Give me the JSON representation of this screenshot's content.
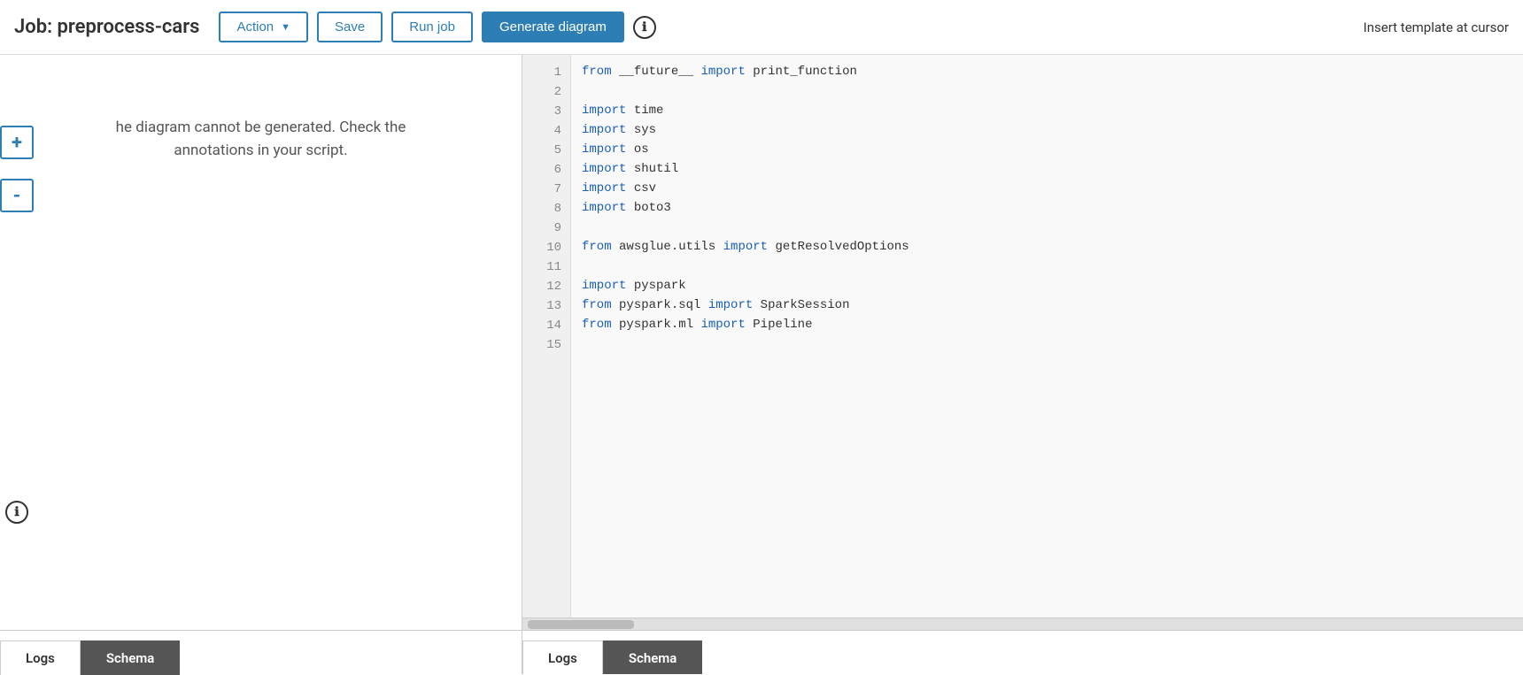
{
  "header": {
    "job_title": "Job: preprocess-cars",
    "action_label": "Action",
    "save_label": "Save",
    "run_job_label": "Run job",
    "generate_diagram_label": "Generate diagram",
    "info_icon": "ℹ",
    "insert_template_label": "Insert template at cursor"
  },
  "left_panel": {
    "error_message_line1": "he diagram cannot be generated. Check the",
    "error_message_line2": "annotations in your script.",
    "zoom_plus": "+",
    "zoom_minus": "-"
  },
  "tabs_left": {
    "logs_label": "Logs",
    "schema_label": "Schema",
    "active": "Schema"
  },
  "code_editor": {
    "lines": [
      {
        "num": 1,
        "code": "from __future__ import print_function"
      },
      {
        "num": 2,
        "code": ""
      },
      {
        "num": 3,
        "code": "import time"
      },
      {
        "num": 4,
        "code": "import sys"
      },
      {
        "num": 5,
        "code": "import os"
      },
      {
        "num": 6,
        "code": "import shutil"
      },
      {
        "num": 7,
        "code": "import csv"
      },
      {
        "num": 8,
        "code": "import boto3"
      },
      {
        "num": 9,
        "code": ""
      },
      {
        "num": 10,
        "code": "from awsglue.utils import getResolvedOptions"
      },
      {
        "num": 11,
        "code": ""
      },
      {
        "num": 12,
        "code": "import pyspark"
      },
      {
        "num": 13,
        "code": "from pyspark.sql import SparkSession"
      },
      {
        "num": 14,
        "code": "from pyspark.ml import Pipeline"
      },
      {
        "num": 15,
        "code": ""
      }
    ]
  },
  "tabs_right": {
    "logs_label": "Logs",
    "schema_label": "Schema",
    "active": "Schema"
  }
}
